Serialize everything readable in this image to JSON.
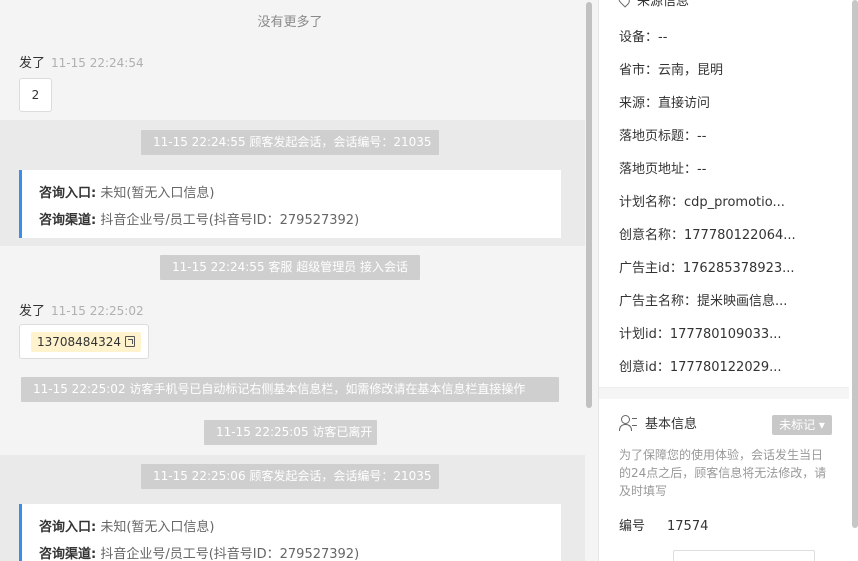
{
  "chat": {
    "no_more": "没有更多了",
    "messages": [
      {
        "sender": "发了",
        "time": "11-15 22:24:54",
        "content": "2"
      },
      {
        "sender": "发了",
        "time": "11-15 22:25:02",
        "content": "13708484324"
      }
    ],
    "system": [
      "11-15 22:24:55 顾客发起会话，会话编号：21035",
      "11-15 22:24:55 客服 超级管理员 接入会话",
      "11-15 22:25:02 访客手机号已自动标记右侧基本信息栏，如需修改请在基本信息栏直接操作",
      "11-15 22:25:05 访客已离开",
      "11-15 22:25:06 顾客发起会话，会话编号：21035"
    ],
    "consult": [
      {
        "entry_label": "咨询入口:",
        "entry_value": "未知(暂无入口信息)",
        "channel_label": "咨询渠道:",
        "channel_value": "抖音企业号/员工号(抖音号ID：279527392)"
      },
      {
        "entry_label": "咨询入口:",
        "entry_value": "未知(暂无入口信息)",
        "channel_label": "咨询渠道:",
        "channel_value": "抖音企业号/员工号(抖音号ID：279527392)"
      }
    ]
  },
  "info": {
    "source_section_title": "来源信息",
    "fields": [
      {
        "label": "设备：",
        "value": "--"
      },
      {
        "label": "省市：",
        "value": "云南，昆明"
      },
      {
        "label": "来源：",
        "value": "直接访问"
      },
      {
        "label": "落地页标题：",
        "value": "--"
      },
      {
        "label": "落地页地址：",
        "value": "--"
      },
      {
        "label": "计划名称：",
        "value": "cdp_promotio..."
      },
      {
        "label": "创意名称：",
        "value": "177780122064..."
      },
      {
        "label": "广告主id：",
        "value": "176285378923..."
      },
      {
        "label": "广告主名称：",
        "value": "提米映画信息..."
      },
      {
        "label": "计划id：",
        "value": "177780109033..."
      },
      {
        "label": "创意id：",
        "value": "177780122029..."
      }
    ],
    "basic": {
      "title": "基本信息",
      "tag_button": "未标记",
      "notice": "为了保障您的使用体验，会话发生当日的24点之后，顾客信息将无法修改，请及时填写",
      "id_label": "编号",
      "id_value": "17574"
    }
  },
  "colors": {
    "accent": "#3a8ee6",
    "phone_highlight": "#fff3cd",
    "system_pill": "#cfcfd0"
  }
}
